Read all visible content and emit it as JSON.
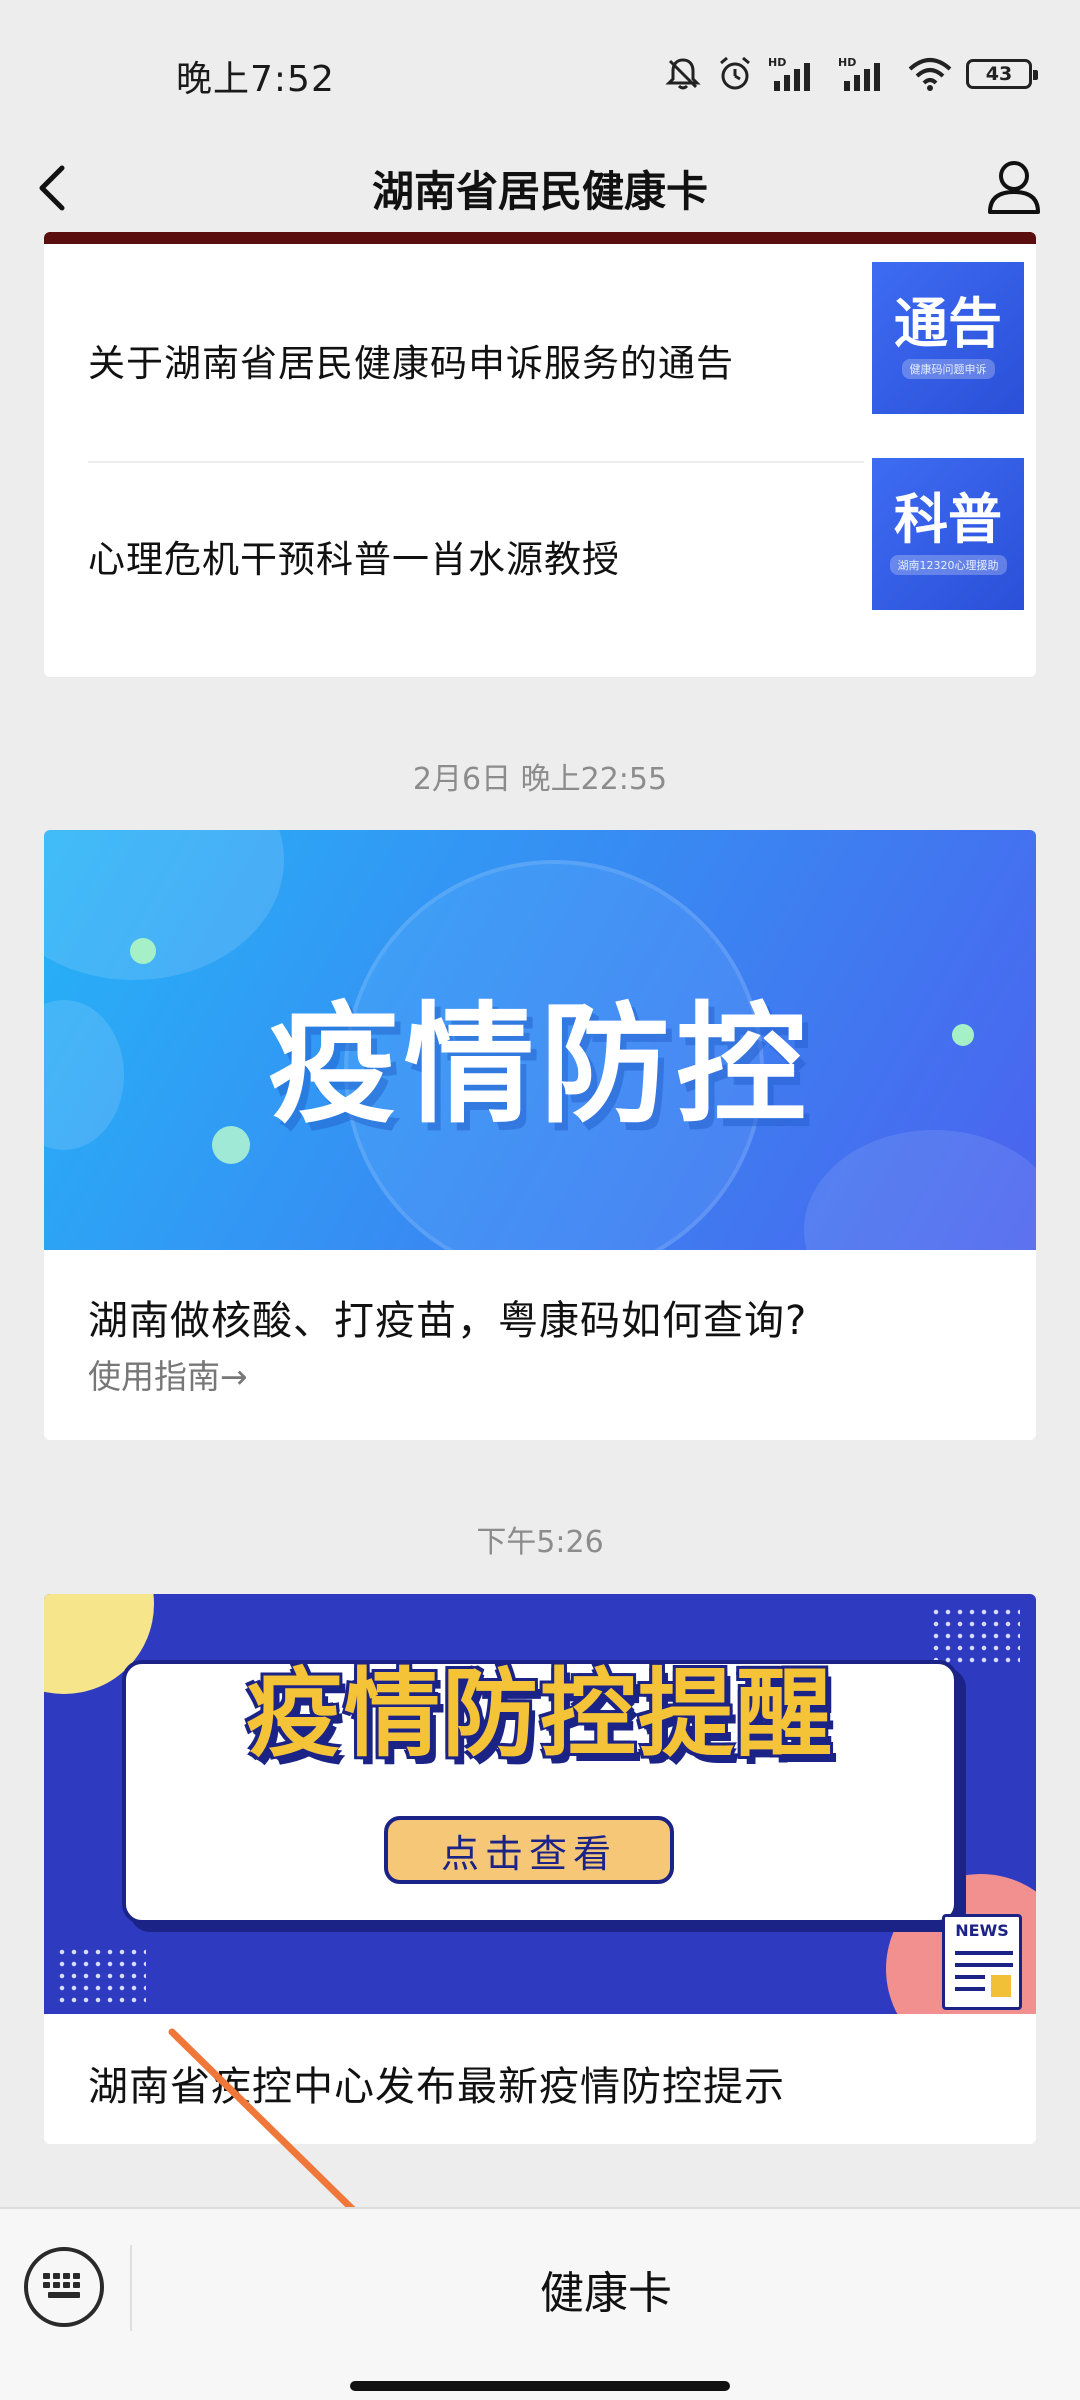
{
  "status": {
    "time": "晚上7:52",
    "battery": "43",
    "icons": [
      "mute-icon",
      "alarm-icon",
      "hd-signal-icon",
      "hd-signal-icon",
      "wifi-icon",
      "battery-icon"
    ]
  },
  "nav": {
    "title": "湖南省居民健康卡",
    "back_icon": "chevron-left-icon",
    "profile_icon": "user-icon"
  },
  "feed": {
    "news_list": [
      {
        "text": "关于湖南省居民健康码申诉服务的通告",
        "thumb_title": "通告",
        "thumb_sub": "健康码问题申诉"
      },
      {
        "text": "心理危机干预科普一肖水源教授",
        "thumb_title": "科普",
        "thumb_sub": "湖南12320心理援助"
      }
    ],
    "timestamp1": "2月6日 晚上22:55",
    "card1": {
      "banner_text": "疫情防控",
      "title": "湖南做核酸、打疫苗，粤康码如何查询?",
      "subtitle": "使用指南→"
    },
    "timestamp2": "下午5:26",
    "card2": {
      "banner_title": "疫情防控提醒",
      "banner_button": "点击查看",
      "banner_news_label": "NEWS",
      "title": "湖南省疾控中心发布最新疫情防控提示"
    }
  },
  "bottom": {
    "keyboard_icon": "keyboard-icon",
    "menu_label": "健康卡"
  },
  "colors": {
    "accent_strip": "#5a0e0e",
    "arrow": "#f0773a",
    "thumb_blue": "#3d6cf2",
    "banner2_blue": "#2e3bc0",
    "banner2_yellow": "#f5c338"
  }
}
